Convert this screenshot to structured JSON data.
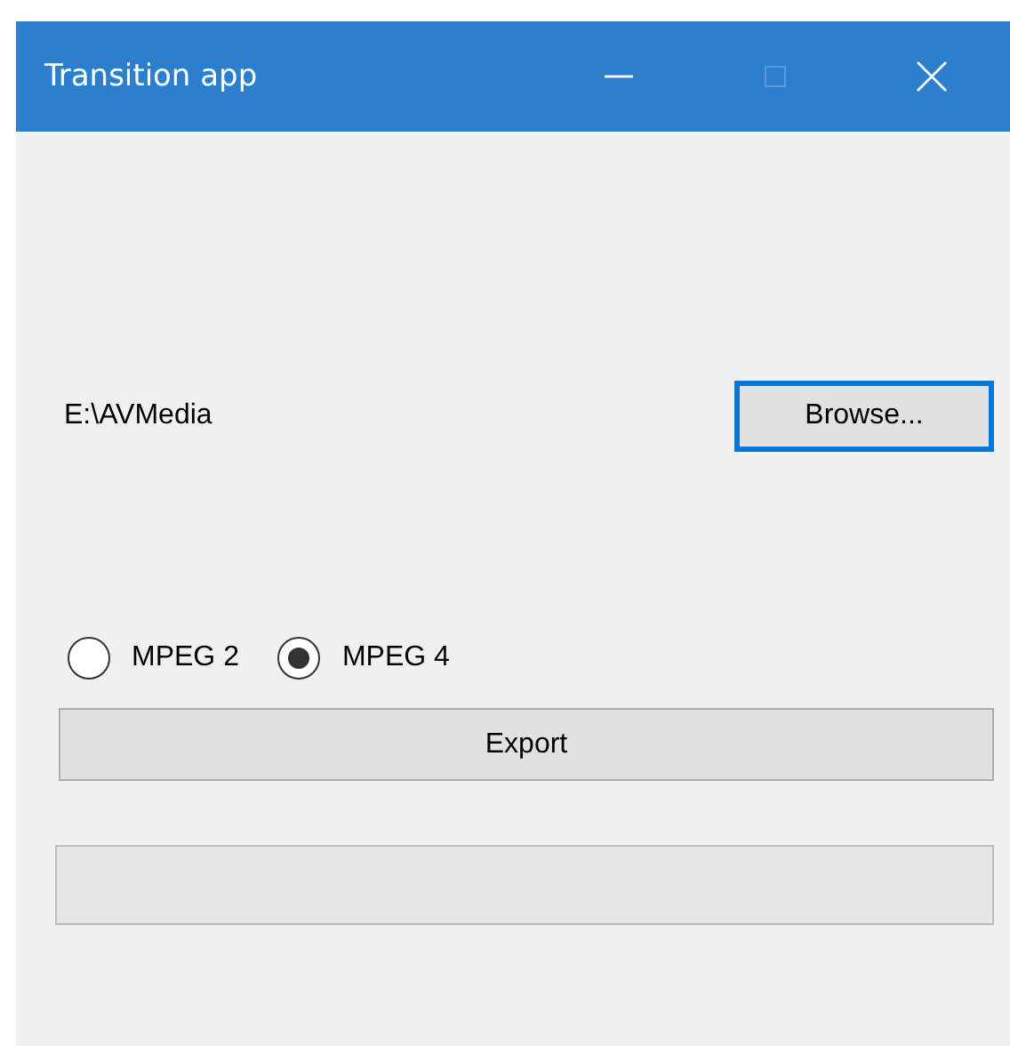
{
  "window": {
    "title": "Transition app",
    "controls": [
      {
        "kind": "minimize",
        "disabled": false
      },
      {
        "kind": "maximize",
        "disabled": true
      },
      {
        "kind": "close",
        "disabled": false
      }
    ]
  },
  "path": "E:\\AVMedia",
  "browse_button": {
    "label": "Browse...",
    "focused": true
  },
  "formats": [
    {
      "label": "MPEG 2",
      "selected": false
    },
    {
      "label": "MPEG 4",
      "selected": true
    }
  ],
  "export_button": {
    "label": "Export"
  }
}
